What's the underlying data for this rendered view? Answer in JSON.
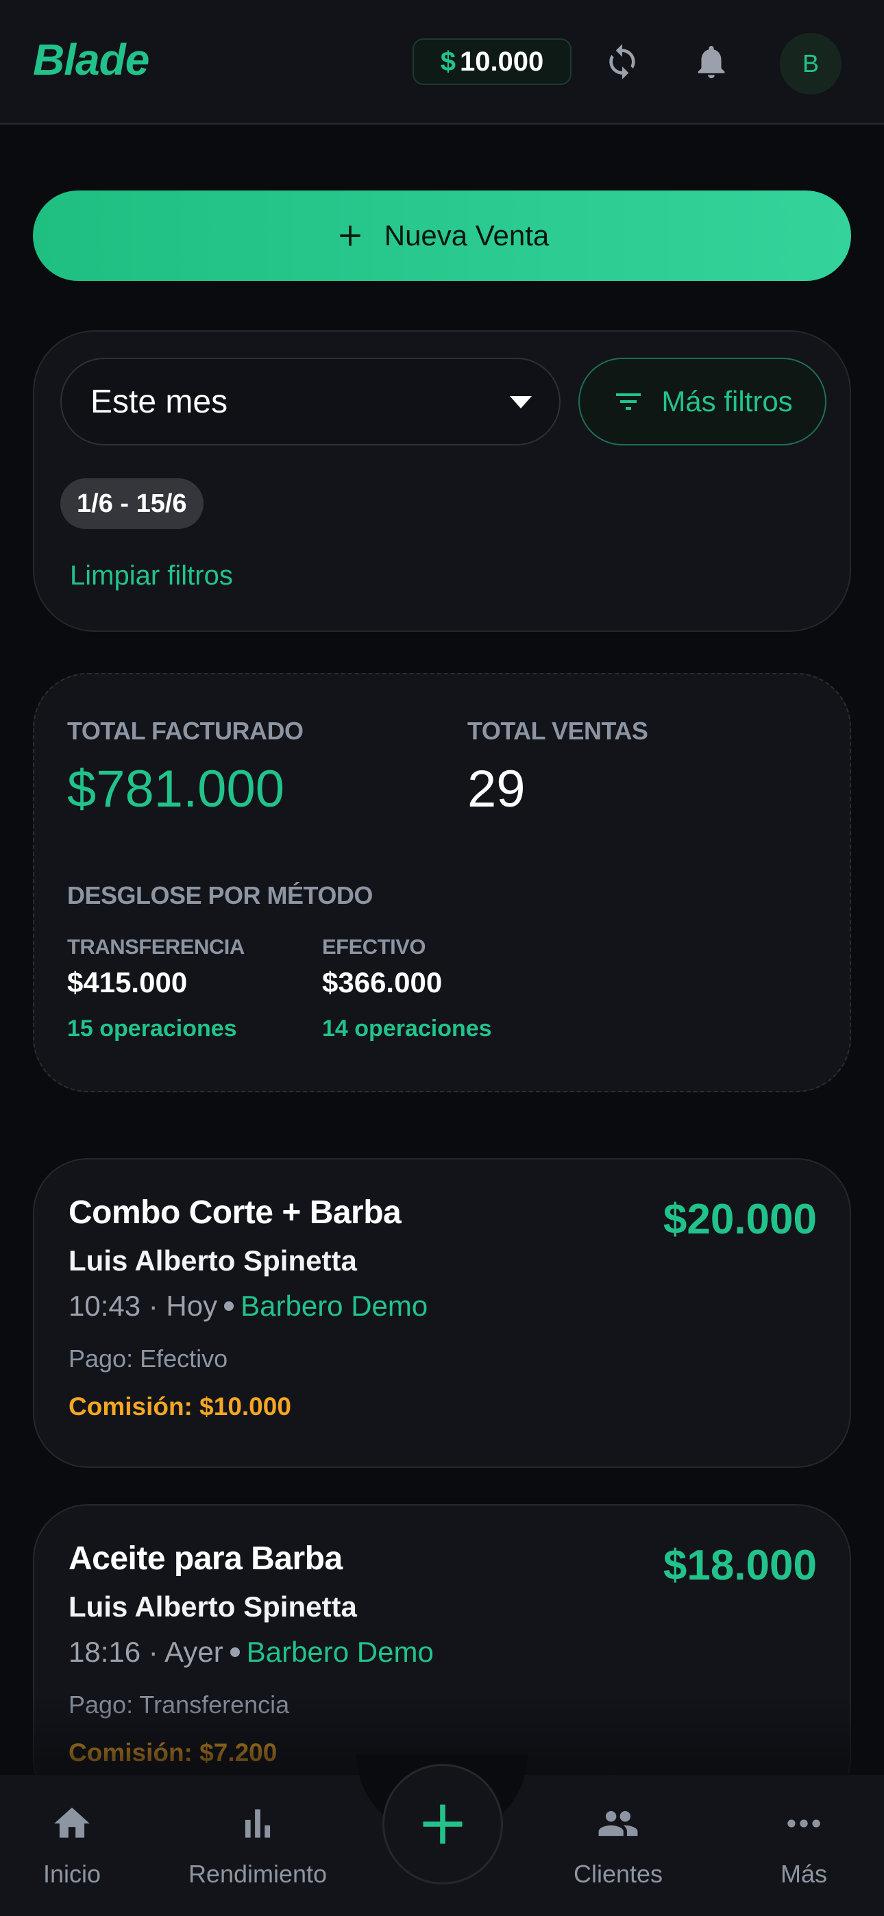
{
  "header": {
    "app_name": "Blade",
    "balance_currency": "$",
    "balance_value": "10.000",
    "icons": {
      "sync": "sync-icon",
      "notifications": "bell-icon"
    },
    "avatar_initial": "B"
  },
  "actions": {
    "new_sale_label": "Nueva Venta"
  },
  "filters": {
    "period_selected": "Este mes",
    "more_filters_label": "Más filtros",
    "date_range_chip": "1/6 - 15/6",
    "clear_filters_label": "Limpiar filtros"
  },
  "summary": {
    "total_billed_label": "TOTAL FACTURADO",
    "total_billed_value": "$781.000",
    "total_sales_label": "TOTAL VENTAS",
    "total_sales_value": "29",
    "breakdown_label": "DESGLOSE POR MÉTODO",
    "methods": [
      {
        "name": "TRANSFERENCIA",
        "amount": "$415.000",
        "operations": "15 operaciones"
      },
      {
        "name": "EFECTIVO",
        "amount": "$366.000",
        "operations": "14 operaciones"
      }
    ]
  },
  "sales": [
    {
      "service": "Combo Corte + Barba",
      "amount": "$20.000",
      "client": "Luis Alberto Spinetta",
      "time": "10:43 · Hoy",
      "barber": "Barbero Demo",
      "payment": "Pago: Efectivo",
      "commission": "Comisión: $10.000"
    },
    {
      "service": "Aceite para Barba",
      "amount": "$18.000",
      "client": "Luis Alberto Spinetta",
      "time": "18:16 · Ayer",
      "barber": "Barbero Demo",
      "payment": "Pago: Transferencia",
      "commission": "Comisión: $7.200"
    }
  ],
  "bottom_nav": {
    "items": [
      {
        "label": "Inicio",
        "icon": "home-icon"
      },
      {
        "label": "Rendimiento",
        "icon": "bar-chart-icon"
      },
      {
        "label": "Clientes",
        "icon": "people-icon"
      },
      {
        "label": "Más",
        "icon": "more-icon"
      }
    ]
  },
  "colors": {
    "accent": "#22c38a",
    "commission": "#f5a623",
    "background": "#0a0b0e",
    "card": "#12141a"
  }
}
